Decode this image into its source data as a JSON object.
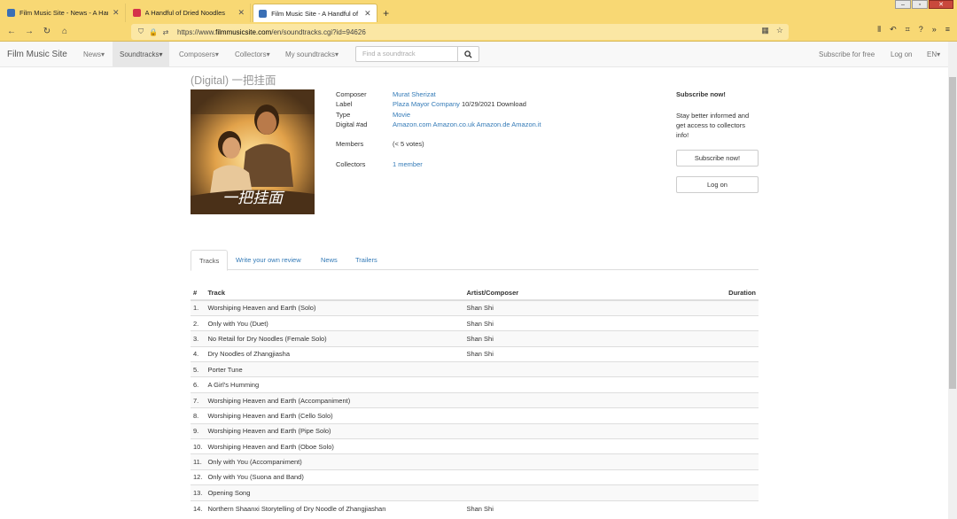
{
  "browser": {
    "tabs": [
      {
        "title": "Film Music Site - News - A Handful of Dried Noodles",
        "favicon_color": "#3a6fb5"
      },
      {
        "title": "A Handful of Dried Noodles",
        "favicon_color": "#d4324a"
      },
      {
        "title": "Film Music Site - A Handful of Dried Noodles",
        "favicon_color": "#3a6fb5"
      }
    ],
    "new_tab": "+",
    "url_prefix": "https://www.",
    "url_domain": "filmmusicsite.com",
    "url_rest": "/en/soundtracks.cgi?id=94626"
  },
  "site": {
    "brand": "Film Music Site",
    "menu": [
      "News",
      "Soundtracks",
      "Composers",
      "Collectors",
      "My soundtracks"
    ],
    "search_placeholder": "Find a soundtrack",
    "subscribe_free": "Subscribe for free",
    "log_on": "Log on",
    "language": "EN"
  },
  "album": {
    "title": "(Digital) 一把挂面",
    "cover_text": "一把挂面",
    "composer_label": "Composer",
    "composer": "Murat Sherizat",
    "label_label": "Label",
    "label": "Plaza Mayor Company",
    "label_extra": "10/29/2021 Download",
    "type_label": "Type",
    "type": "Movie",
    "digital_label": "Digital #ad",
    "stores": [
      "Amazon.com",
      "Amazon.co.uk",
      "Amazon.de",
      "Amazon.it"
    ],
    "members_label": "Members",
    "members": "(< 5 votes)",
    "collectors_label": "Collectors",
    "collectors": "1 member"
  },
  "subscribe": {
    "heading": "Subscribe now!",
    "text": "Stay better informed and get access to collectors info!",
    "button": "Subscribe now!",
    "logon_button": "Log on"
  },
  "content_tabs": [
    "Tracks",
    "Write your own review",
    "News",
    "Trailers"
  ],
  "tracks": {
    "headers": [
      "#",
      "Track",
      "Artist/Composer",
      "Duration"
    ],
    "rows": [
      {
        "n": "1.",
        "track": "Worshiping Heaven and Earth (Solo)",
        "artist": "Shan Shi"
      },
      {
        "n": "2.",
        "track": "Only with You (Duet)",
        "artist": "Shan Shi"
      },
      {
        "n": "3.",
        "track": "No Retail for Dry Noodles (Female Solo)",
        "artist": "Shan Shi"
      },
      {
        "n": "4.",
        "track": "Dry Noodles of Zhangjiasha",
        "artist": "Shan Shi"
      },
      {
        "n": "5.",
        "track": "Porter Tune",
        "artist": ""
      },
      {
        "n": "6.",
        "track": "A Girl's Humming",
        "artist": ""
      },
      {
        "n": "7.",
        "track": "Worshiping Heaven and Earth (Accompaniment)",
        "artist": ""
      },
      {
        "n": "8.",
        "track": "Worshiping Heaven and Earth (Cello Solo)",
        "artist": ""
      },
      {
        "n": "9.",
        "track": "Worshiping Heaven and Earth (Pipe Solo)",
        "artist": ""
      },
      {
        "n": "10.",
        "track": "Worshiping Heaven and Earth (Oboe Solo)",
        "artist": ""
      },
      {
        "n": "11.",
        "track": "Only with You (Accompaniment)",
        "artist": ""
      },
      {
        "n": "12.",
        "track": "Only with You (Suona and Band)",
        "artist": ""
      },
      {
        "n": "13.",
        "track": "Opening Song",
        "artist": ""
      },
      {
        "n": "14.",
        "track": "Northern Shaanxi Storytelling of Dry Noodle of Zhangjiashan",
        "artist": "Shan Shi"
      }
    ]
  }
}
